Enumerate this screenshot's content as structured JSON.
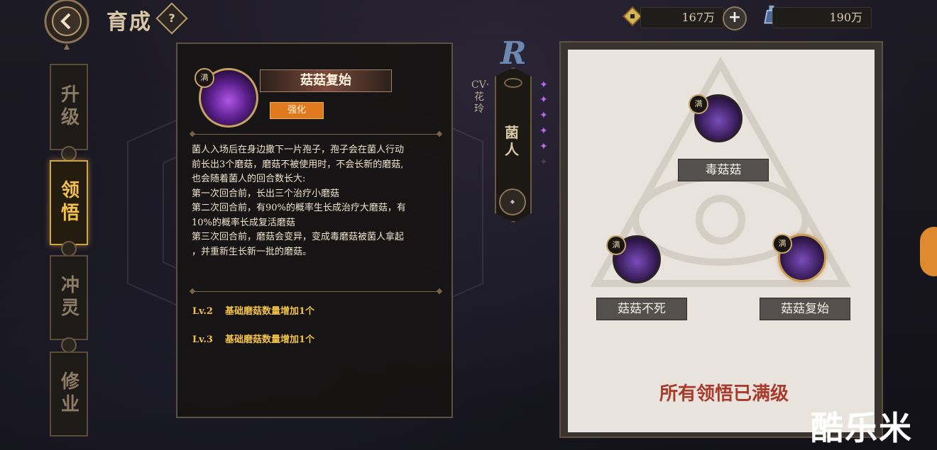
{
  "header": {
    "title": "育成",
    "help_label": "?"
  },
  "resources": [
    {
      "icon": "coin-icon",
      "value": "167万"
    },
    {
      "icon": "potion-icon",
      "value": "190万"
    }
  ],
  "side_tabs": [
    {
      "label": "升级",
      "active": false
    },
    {
      "label": "领悟",
      "active": true
    },
    {
      "label": "冲灵",
      "active": false
    },
    {
      "label": "修业",
      "active": false
    }
  ],
  "skill_detail": {
    "badge": "满",
    "name": "菇菇复始",
    "tag": "强化",
    "description": [
      "菌人入场后在身边撒下一片孢子，孢子会在菌人行动",
      "前长出3个磨菇，磨菇不被使用时，不会长新的磨菇,",
      "也会随着菌人的回合数长大:",
      "第一次回合前，长出三个治疗小磨菇",
      "第二次回合前，有90%的概率生长成治疗大磨菇，有",
      "10%的概率长成复活磨菇",
      "第三次回合前，磨菇会变异，变成毒磨菇被菌人拿起",
      "，并重新生长新一批的磨菇。"
    ],
    "levels": [
      {
        "lv": "Lv.2",
        "text": "基础磨菇数量增加1个"
      },
      {
        "lv": "Lv.3",
        "text": "基础磨菇数量增加1个"
      }
    ]
  },
  "character": {
    "rank": "R",
    "cv": "CV·花玲",
    "name": "菌人"
  },
  "tree": {
    "nodes": [
      {
        "badge": "满",
        "label": "毒菇菇",
        "selected": false
      },
      {
        "badge": "满",
        "label": "菇菇不死",
        "selected": false
      },
      {
        "badge": "满",
        "label": "菇菇复始",
        "selected": true
      }
    ],
    "status": "所有领悟已满级"
  },
  "watermark": "酷乐米",
  "colors": {
    "accent_gold": "#f4c14c",
    "tag_orange": "#e07a1e",
    "status_red": "#a83b2b"
  }
}
